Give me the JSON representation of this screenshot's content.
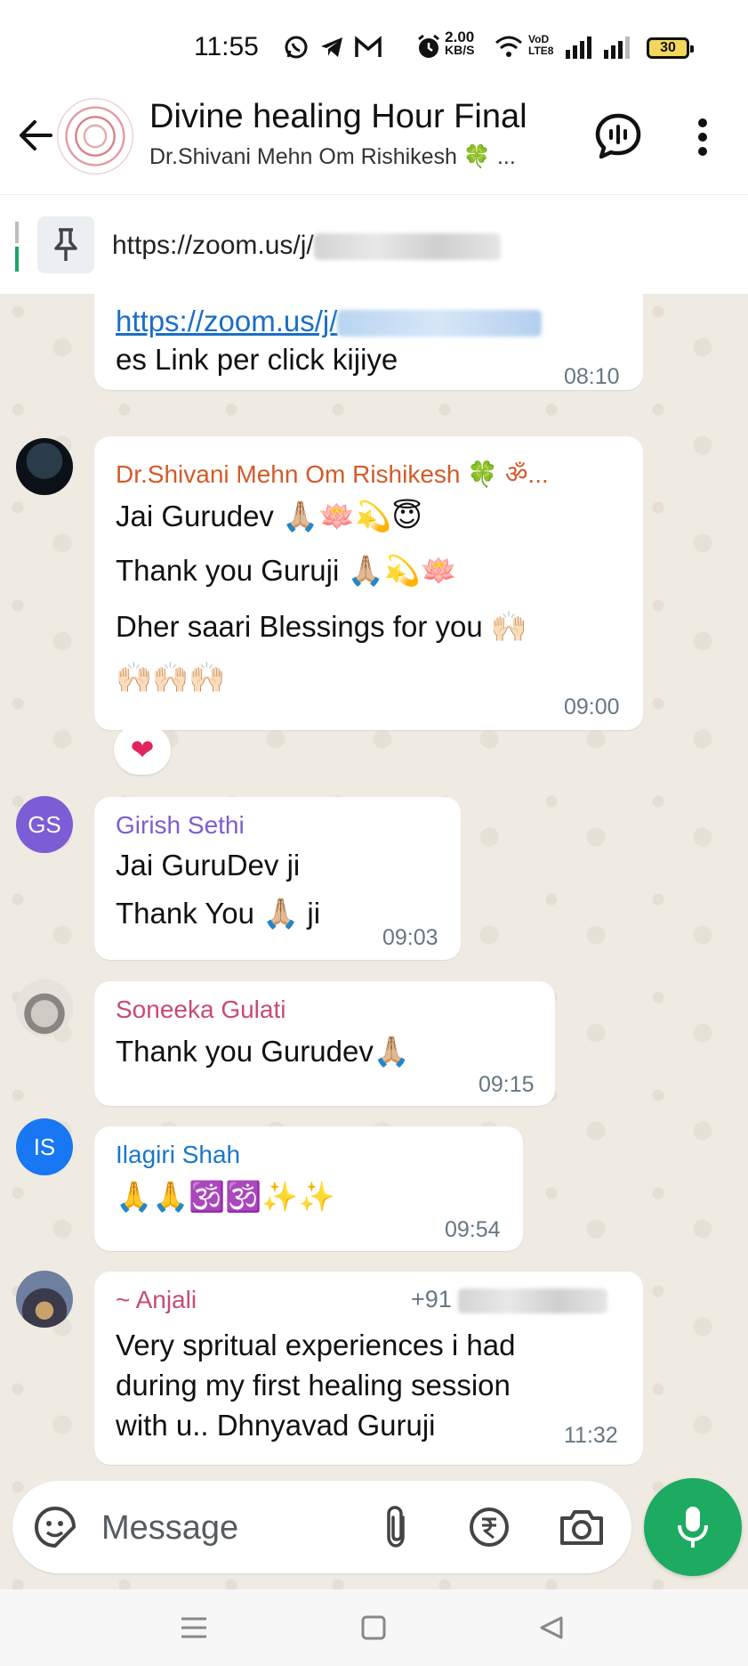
{
  "status_bar": {
    "time": "11:55",
    "net_speed_value": "2.00",
    "net_speed_unit": "KB/S",
    "volte_top": "VoD",
    "volte_bottom": "LTE8",
    "battery": "30"
  },
  "header": {
    "title": "Divine healing Hour Final",
    "subtitle": "Dr.Shivani Mehn Om Rishikesh 🍀 ..."
  },
  "pinned": {
    "text": "https://zoom.us/j/"
  },
  "messages": {
    "m0": {
      "link": "https://zoom.us/j/",
      "line2": "es Link per click kijiye",
      "time": "08:10"
    },
    "m1": {
      "sender": "Dr.Shivani Mehn Om Rishikesh 🍀 ॐ...",
      "line1": "Jai Gurudev 🙏🏼🪷💫😇",
      "line2": "Thank you Guruji 🙏🏼💫🪷",
      "line3": "Dher saari Blessings for you 🙌🏻",
      "line4": "🙌🏻🙌🏻🙌🏻",
      "time": "09:00",
      "reaction": "❤"
    },
    "m2": {
      "initials": "GS",
      "sender": "Girish Sethi",
      "line1": "Jai GuruDev ji",
      "line2": "Thank You 🙏🏼 ji",
      "time": "09:03"
    },
    "m3": {
      "sender": "Soneeka Gulati",
      "line1": "Thank you Gurudev🙏🏼",
      "time": "09:15"
    },
    "m4": {
      "initials": "IS",
      "sender": "Ilagiri Shah",
      "line1": "🙏🙏🕉️🕉️✨✨",
      "time": "09:54"
    },
    "m5": {
      "sender": "~ Anjali",
      "phone_prefix": "+91",
      "line1": "Very spritual experiences i had",
      "line2": "during my first healing session",
      "line3": "with u.. Dhnyavad Guruji",
      "time": "11:32"
    }
  },
  "composer": {
    "placeholder": "Message"
  },
  "colors": {
    "accent_green": "#1daa61",
    "sender_orange": "#d35b29",
    "sender_purple": "#7b5fcf",
    "sender_pink": "#c74a78",
    "sender_blue": "#1877c9",
    "chat_bg": "#efeae2"
  }
}
